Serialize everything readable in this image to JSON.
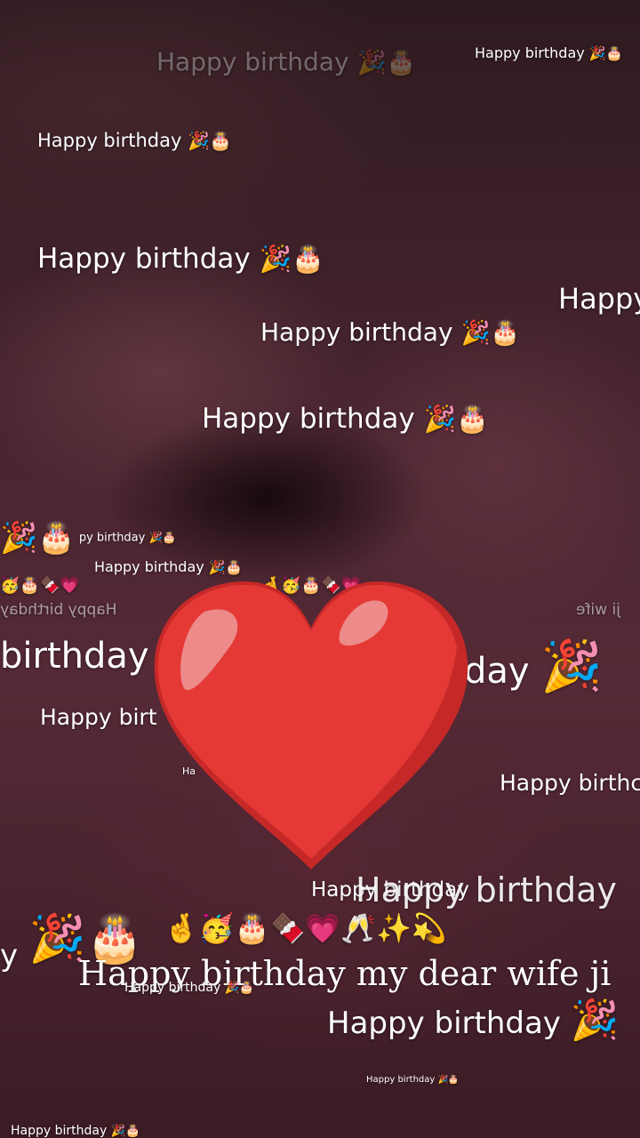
{
  "wishes": {
    "short": "Happy birthday",
    "short_emoji": "🎉🎂",
    "ghost_1": "Happy birthday",
    "ghost_2": "Happy birthday",
    "top_right": "Happy birthday",
    "line_1": "Happy birthday",
    "line_2": "Happy birthday",
    "line_3": "Happy birthday",
    "line_4": "Happy birthday",
    "partial_right": "Happy",
    "small_left": "py birthday",
    "small_mid": "Happy birthday",
    "mirrored_left": "Happy birthday",
    "partial_day": "day",
    "mirrored_right": "ji wife",
    "big_left": "birthday",
    "big_right": "day",
    "mid_left": "Happy birt",
    "mid_right": "Happy birthc",
    "overlap_a": "Happy birthday",
    "overlap_b": "Happy birthday",
    "tiny_mid": "Ha",
    "main_message": "Happy birthday my dear wife ji",
    "under_message": "Happy birthday",
    "bottom_right": "Happy birthday",
    "tiny_bottom": "Happy birthday",
    "bottom_left": "Happy birthday",
    "edge_y": "y"
  },
  "emoji": {
    "party_cake": "🎉🎂",
    "row_left": "🤞🥳🎂🍫💗🥂✨💫",
    "row_top_strip": "🤞🥳🎂🍫💗",
    "row_mid_strip": "🥳🎂🍫💗",
    "heart": "heart-icon",
    "party": "🎉",
    "cake": "🎂"
  },
  "colors": {
    "heart_main": "#e53935",
    "heart_shadow": "#c62828",
    "heart_highlight": "#ef9a9a"
  }
}
